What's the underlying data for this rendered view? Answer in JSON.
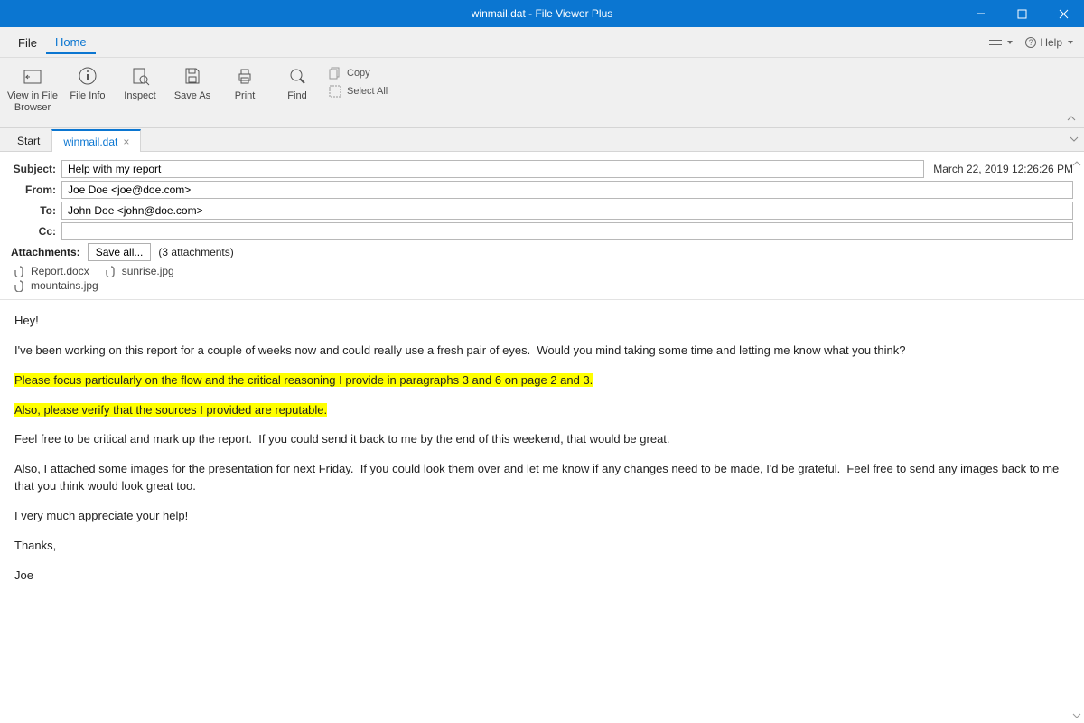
{
  "title": "winmail.dat - File Viewer Plus",
  "menus": {
    "file": "File",
    "home": "Home"
  },
  "menuright": {
    "help": "Help"
  },
  "ribbon": {
    "view_in_file_browser": "View in File\nBrowser",
    "file_info": "File Info",
    "inspect": "Inspect",
    "save_as": "Save As",
    "print": "Print",
    "find": "Find",
    "copy": "Copy",
    "select_all": "Select All"
  },
  "tabs": {
    "start": "Start",
    "file": "winmail.dat"
  },
  "labels": {
    "subject": "Subject:",
    "from": "From:",
    "to": "To:",
    "cc": "Cc:",
    "attachments": "Attachments:",
    "save_all": "Save all...",
    "count": "(3 attachments)"
  },
  "fields": {
    "subject": "Help with my report",
    "from": "Joe Doe <joe@doe.com>",
    "to": "John Doe <john@doe.com>",
    "cc": ""
  },
  "date": "March 22, 2019 12:26:26 PM",
  "attachments": [
    "Report.docx",
    "sunrise.jpg",
    "mountains.jpg"
  ],
  "body": {
    "p1": "Hey!",
    "p2": "I've been working on this report for a couple of weeks now and could really use a fresh pair of eyes.  Would you mind taking some time and letting me know what you think?",
    "p3": "Please focus particularly on the flow and the critical reasoning I provide in paragraphs 3 and 6 on page 2 and 3.",
    "p4": "Also, please verify that the sources I provided are reputable.",
    "p5": "Feel free to be critical and mark up the report.  If you could send it back to me by the end of this weekend, that would be great.",
    "p6": "Also, I attached some images for the presentation for next Friday.  If you could look them over and let me know if any changes need to be made, I'd be grateful.  Feel free to send any images back to me that you think would look great too.",
    "p7": "I very much appreciate your help!",
    "p8": "Thanks,",
    "p9": "Joe"
  }
}
